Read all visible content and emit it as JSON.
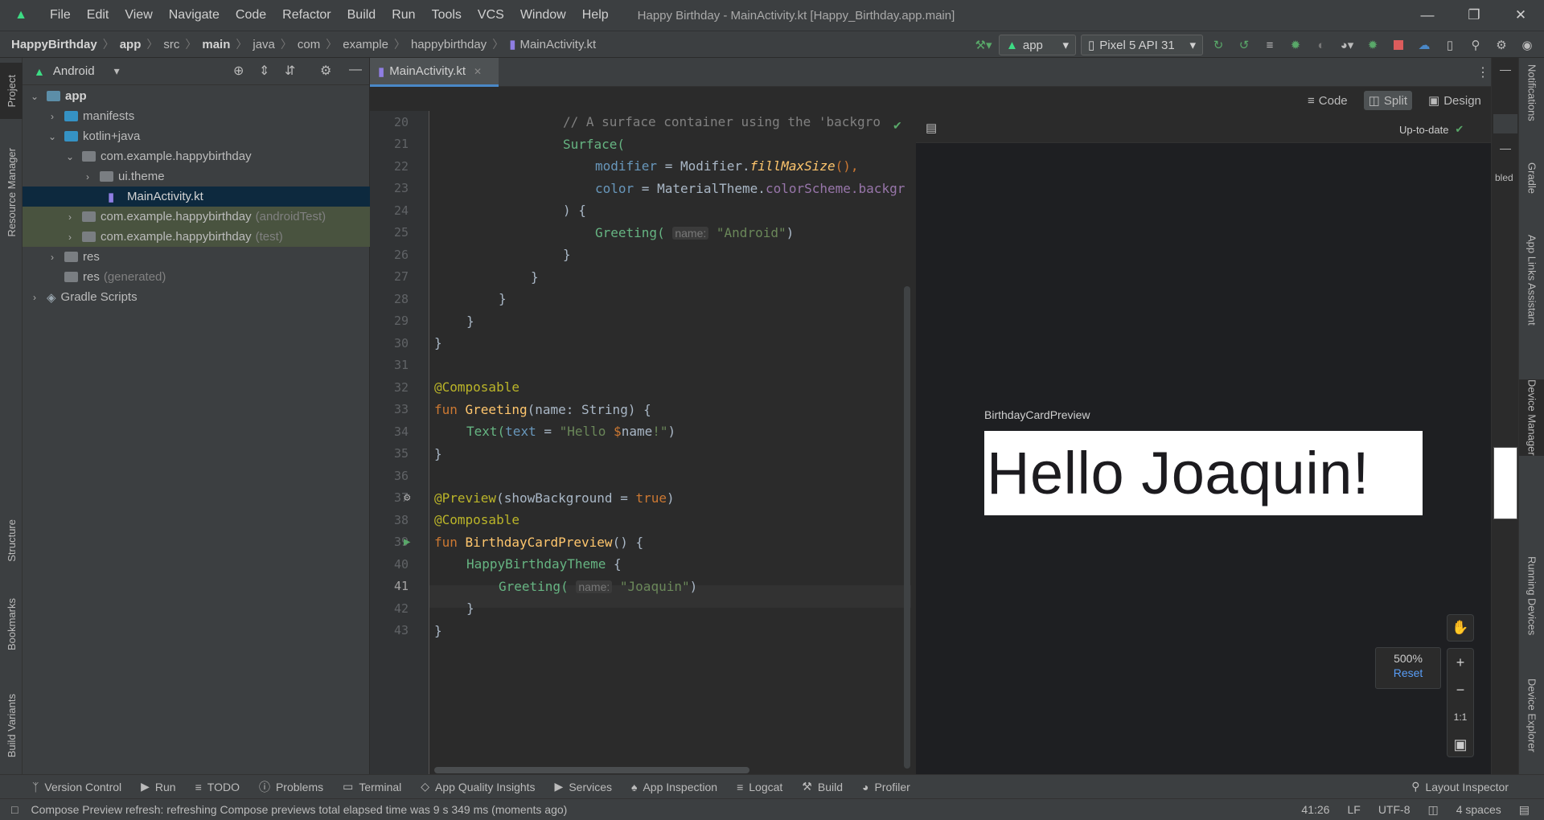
{
  "menu": [
    "File",
    "Edit",
    "View",
    "Navigate",
    "Code",
    "Refactor",
    "Build",
    "Run",
    "Tools",
    "VCS",
    "Window",
    "Help"
  ],
  "window_title": "Happy Birthday - MainActivity.kt [Happy_Birthday.app.main]",
  "breadcrumbs": [
    "HappyBirthday",
    "app",
    "src",
    "main",
    "java",
    "com",
    "example",
    "happybirthday",
    "MainActivity.kt"
  ],
  "toolbar": {
    "run_config": "app",
    "device": "Pixel 5 API 31"
  },
  "left_tabs": {
    "project": "Project",
    "resource_manager": "Resource Manager",
    "structure": "Structure",
    "bookmarks": "Bookmarks",
    "build_variants": "Build Variants"
  },
  "project_panel": {
    "view_mode": "Android",
    "tree": [
      {
        "label": "app",
        "extra": ""
      },
      {
        "label": "manifests",
        "extra": ""
      },
      {
        "label": "kotlin+java",
        "extra": ""
      },
      {
        "label": "com.example.happybirthday",
        "extra": ""
      },
      {
        "label": "ui.theme",
        "extra": ""
      },
      {
        "label": "MainActivity.kt",
        "extra": ""
      },
      {
        "label": "com.example.happybirthday",
        "extra": "(androidTest)"
      },
      {
        "label": "com.example.happybirthday",
        "extra": "(test)"
      },
      {
        "label": "res",
        "extra": ""
      },
      {
        "label": "res",
        "extra": "(generated)"
      },
      {
        "label": "Gradle Scripts",
        "extra": ""
      }
    ]
  },
  "editor": {
    "tab_label": "MainActivity.kt",
    "line_numbers": [
      "20",
      "21",
      "22",
      "23",
      "24",
      "25",
      "26",
      "27",
      "28",
      "29",
      "30",
      "31",
      "32",
      "33",
      "34",
      "35",
      "36",
      "37",
      "38",
      "39",
      "40",
      "41",
      "42",
      "43"
    ],
    "current_line": "41"
  },
  "code": {
    "l20": "// A surface container using the 'backgro",
    "l21": "Surface(",
    "l22_a": "modifier",
    "l22_b": " = Modifier.",
    "l22_c": "fillMaxSize",
    "l22_d": "(),",
    "l23_a": "color",
    "l23_b": " = MaterialTheme.",
    "l23_c": "colorScheme",
    "l23_d": ".backgr",
    "l24": ") {",
    "l25_a": "Greeting(",
    "l25_hint": "name:",
    "l25_str": "\"Android\"",
    "l25_end": ")",
    "brace": "}",
    "l32": "@Composable",
    "l33_kw": "fun ",
    "l33_fn": "Greeting",
    "l33_rest": "(name: String) {",
    "l34_a": "Text(",
    "l34_b": "text",
    "l34_c": " = ",
    "l34_d": "\"Hello ",
    "l34_e": "$",
    "l34_f": "name",
    "l34_g": "!\"",
    "l34_h": ")",
    "l37_a": "@Preview",
    "l37_b": "(showBackground = ",
    "l37_c": "true",
    "l37_d": ")",
    "l38": "@Composable",
    "l39_kw": "fun ",
    "l39_fn": "BirthdayCardPreview",
    "l39_rest": "() {",
    "l40_a": "HappyBirthdayTheme",
    "l40_b": " {",
    "l41_a": "Greeting(",
    "l41_hint": "name:",
    "l41_str": "\"Joaquin\"",
    "l41_end": ")"
  },
  "preview": {
    "modes": [
      "Code",
      "Split",
      "Design"
    ],
    "active_mode": "Split",
    "status": "Up-to-date",
    "composable_name": "BirthdayCardPreview",
    "rendered_text": "Hello Joaquin!",
    "zoom": "500%",
    "reset": "Reset",
    "one_to_one": "1:1",
    "partial_label": "bled"
  },
  "right_tabs": {
    "notifications": "Notifications",
    "gradle": "Gradle",
    "app_links": "App Links Assistant",
    "device_manager": "Device Manager",
    "running_devices": "Running Devices",
    "device_explorer": "Device Explorer"
  },
  "bottom_tools": [
    "Version Control",
    "Run",
    "TODO",
    "Problems",
    "Terminal",
    "App Quality Insights",
    "Services",
    "App Inspection",
    "Logcat",
    "Build",
    "Profiler"
  ],
  "layout_inspector": "Layout Inspector",
  "status": {
    "message": "Compose Preview refresh: refreshing Compose previews total elapsed time was 9 s 349 ms (moments ago)",
    "position": "41:26",
    "line_sep": "LF",
    "encoding": "UTF-8",
    "indent": "4 spaces"
  },
  "colors": {
    "accent": "#4a88c7",
    "android_green": "#3ddc84",
    "selection": "#0d293e"
  }
}
